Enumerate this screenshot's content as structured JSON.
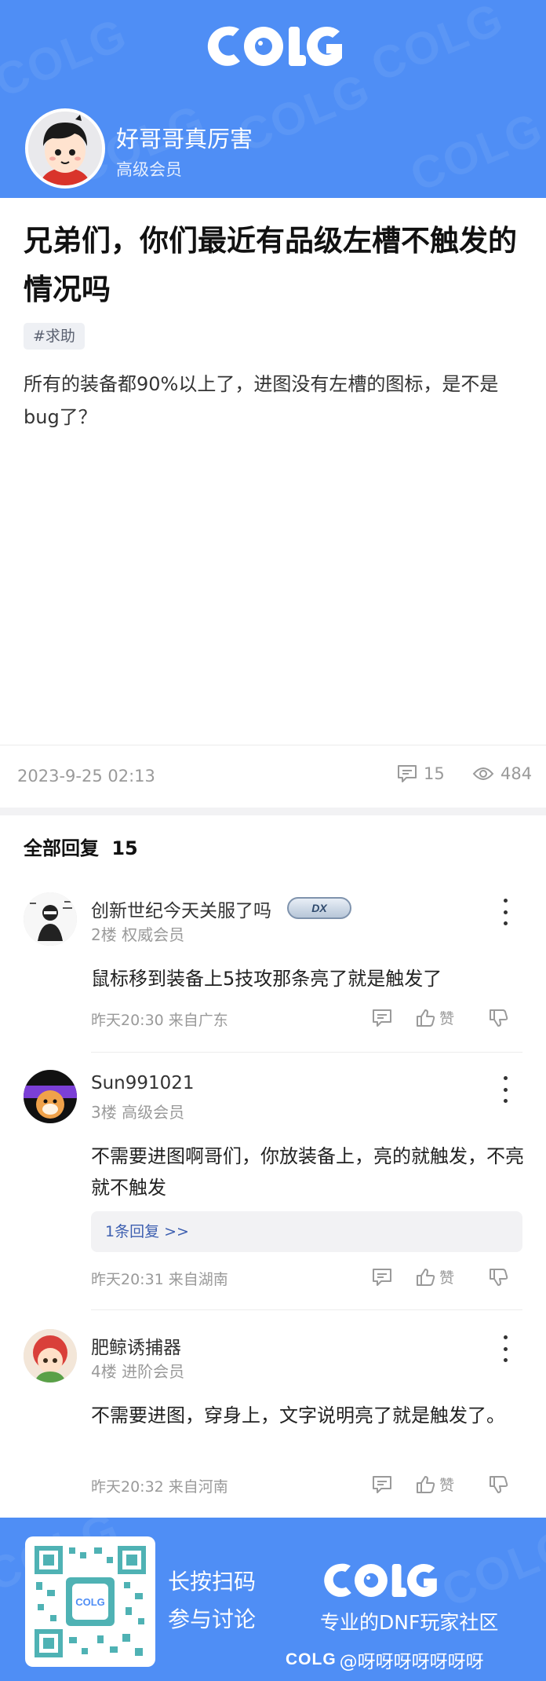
{
  "brand": {
    "logo_text": "COLG",
    "accent": "#4f8ef5"
  },
  "author": {
    "name": "好哥哥真厉害",
    "level": "高级会员"
  },
  "post": {
    "title": "兄弟们，你们最近有品级左槽不触发的情况吗",
    "tag": "#求助",
    "body": "所有的装备都90%以上了，进图没有左槽的图标，是不是bug了？",
    "datetime": "2023-9-25 02:13",
    "comment_count": "15",
    "view_count": "484"
  },
  "replies_header": {
    "label": "全部回复",
    "count": "15"
  },
  "replies": [
    {
      "name": "创新世纪今天关服了吗",
      "badge": "DX",
      "floor_level": "2楼  权威会员",
      "text": "鼠标移到装备上5技攻那条亮了就是触发了",
      "time_location": "昨天20:30 来自广东",
      "like_label": "赞"
    },
    {
      "name": "Sun991021",
      "floor_level": "3楼  高级会员",
      "text": "不需要进图啊哥们，你放装备上，亮的就触发，不亮就不触发",
      "sub_reply": "1条回复 >>",
      "time_location": "昨天20:31 来自湖南",
      "like_label": "赞"
    },
    {
      "name": "肥鲸诱捕器",
      "floor_level": "4楼  进阶会员",
      "text": "不需要进图，穿身上，文字说明亮了就是触发了。",
      "time_location": "昨天20:32 来自河南",
      "like_label": "赞"
    }
  ],
  "footer": {
    "scan_line1": "长按扫码",
    "scan_line2": "参与讨论",
    "slogan": "专业的DNF玩家社区",
    "credit": "@呀呀呀呀呀呀呀"
  }
}
